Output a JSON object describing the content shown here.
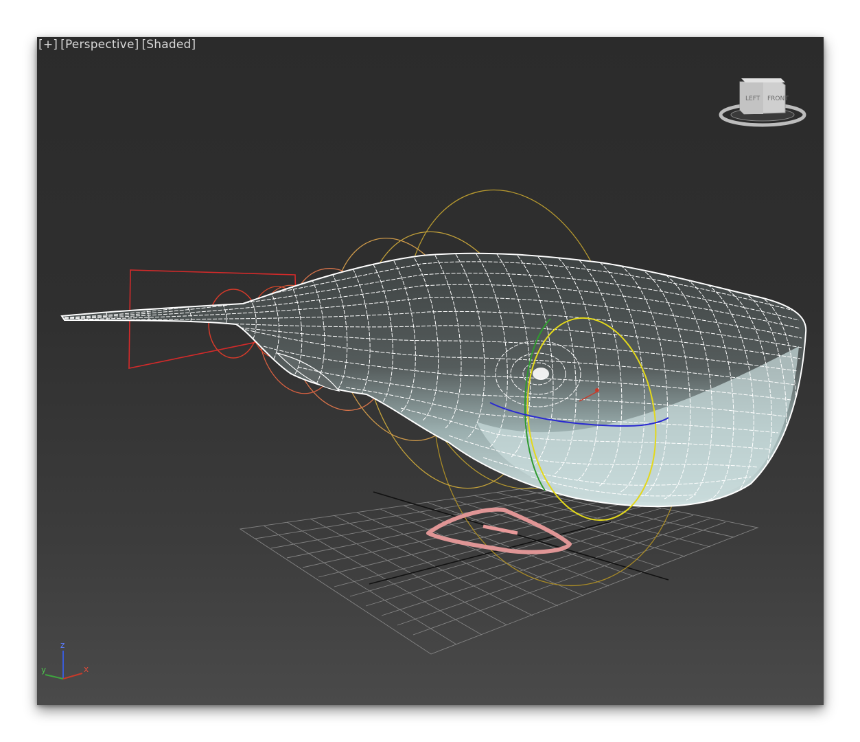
{
  "viewport": {
    "plus_label": "[+]",
    "view_label": "[Perspective]",
    "shading_label": "[Shaded]"
  },
  "viewcube": {
    "left_face": "LEFT",
    "front_face": "FRONT"
  },
  "axis_tripod": {
    "z_label": "z",
    "y_label": "y",
    "x_label": "x",
    "z_color": "#3a5bd8",
    "y_color": "#3fa53f",
    "x_color": "#c83a2a"
  },
  "colors": {
    "wireframe": "#ffffff",
    "control_red": "#d42a2a",
    "control_orange": "#d9744a",
    "control_gold": "#b89a2f",
    "control_yellow": "#e3d81a",
    "control_green": "#2f9a2f",
    "control_blue": "#2a2ad0",
    "root_control": "#e89a9a",
    "grid": "#9a9a9a"
  }
}
